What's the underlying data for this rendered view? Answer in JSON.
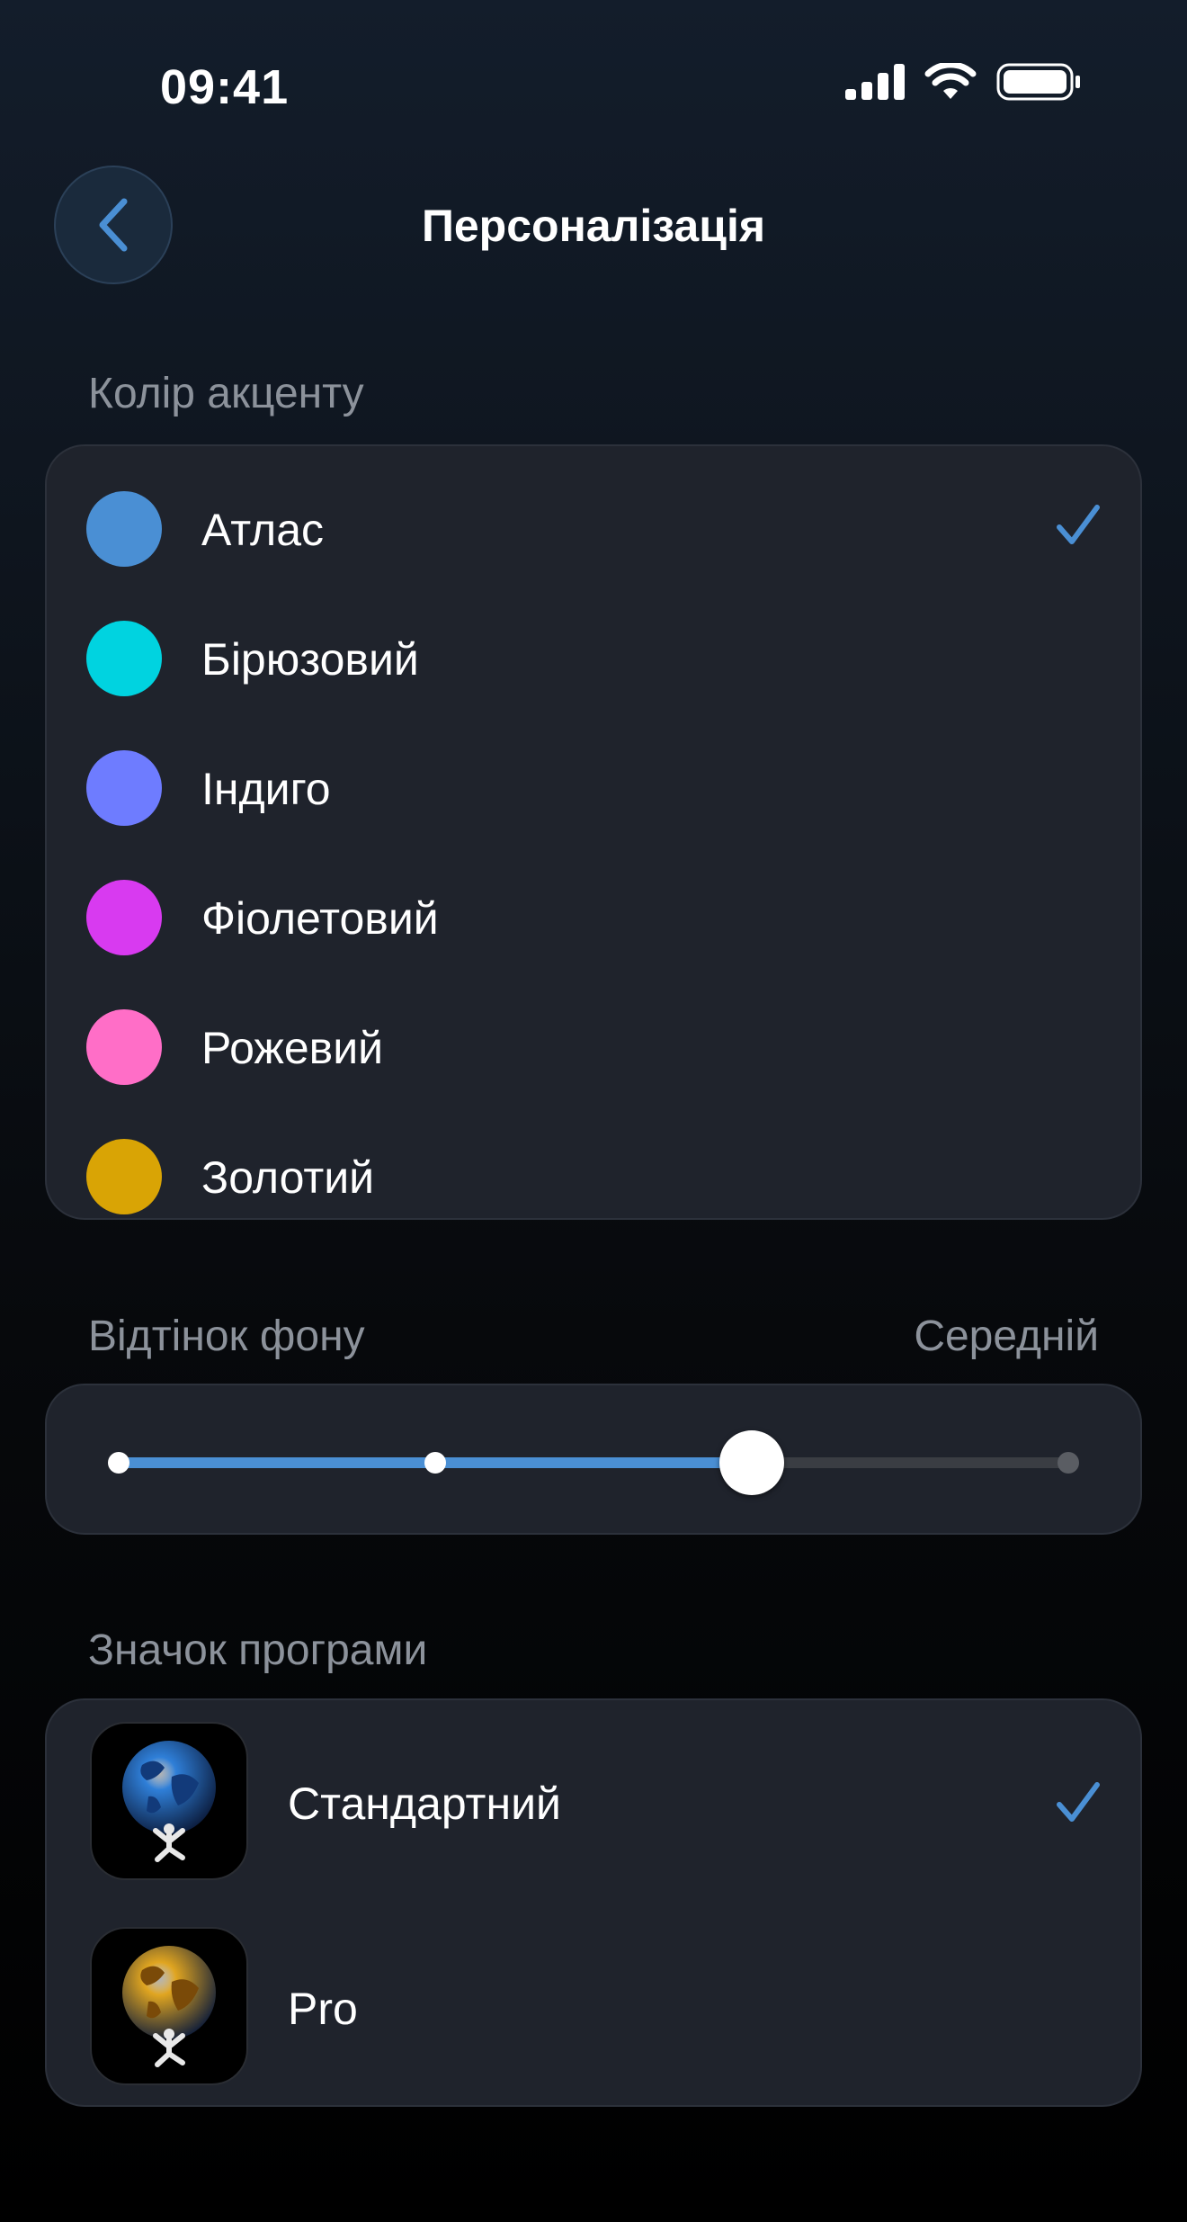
{
  "status_bar": {
    "time": "09:41"
  },
  "header": {
    "title": "Персоналізація",
    "back_icon": "chevron-left-icon"
  },
  "accent_section": {
    "label": "Колір акценту",
    "items": [
      {
        "label": "Атлас",
        "color": "#4a8fd4",
        "selected": true
      },
      {
        "label": "Бірюзовий",
        "color": "#00d3e0",
        "selected": false
      },
      {
        "label": "Індиго",
        "color": "#6e7cff",
        "selected": false
      },
      {
        "label": "Фіолетовий",
        "color": "#d83af0",
        "selected": false
      },
      {
        "label": "Рожевий",
        "color": "#ff6ec7",
        "selected": false
      },
      {
        "label": "Золотий",
        "color": "#d9a405",
        "selected": false
      }
    ]
  },
  "background_tint": {
    "label": "Відтінок фону",
    "value": "Середній",
    "steps": 4,
    "selected_index": 2
  },
  "app_icon_section": {
    "label": "Значок програми",
    "items": [
      {
        "label": "Стандартний",
        "icon": "atlas-blue-globe-icon",
        "selected": true
      },
      {
        "label": "Pro",
        "icon": "atlas-gold-globe-icon",
        "selected": false
      }
    ]
  },
  "colors": {
    "accent": "#4a8fd4",
    "card": "#1f232c"
  }
}
